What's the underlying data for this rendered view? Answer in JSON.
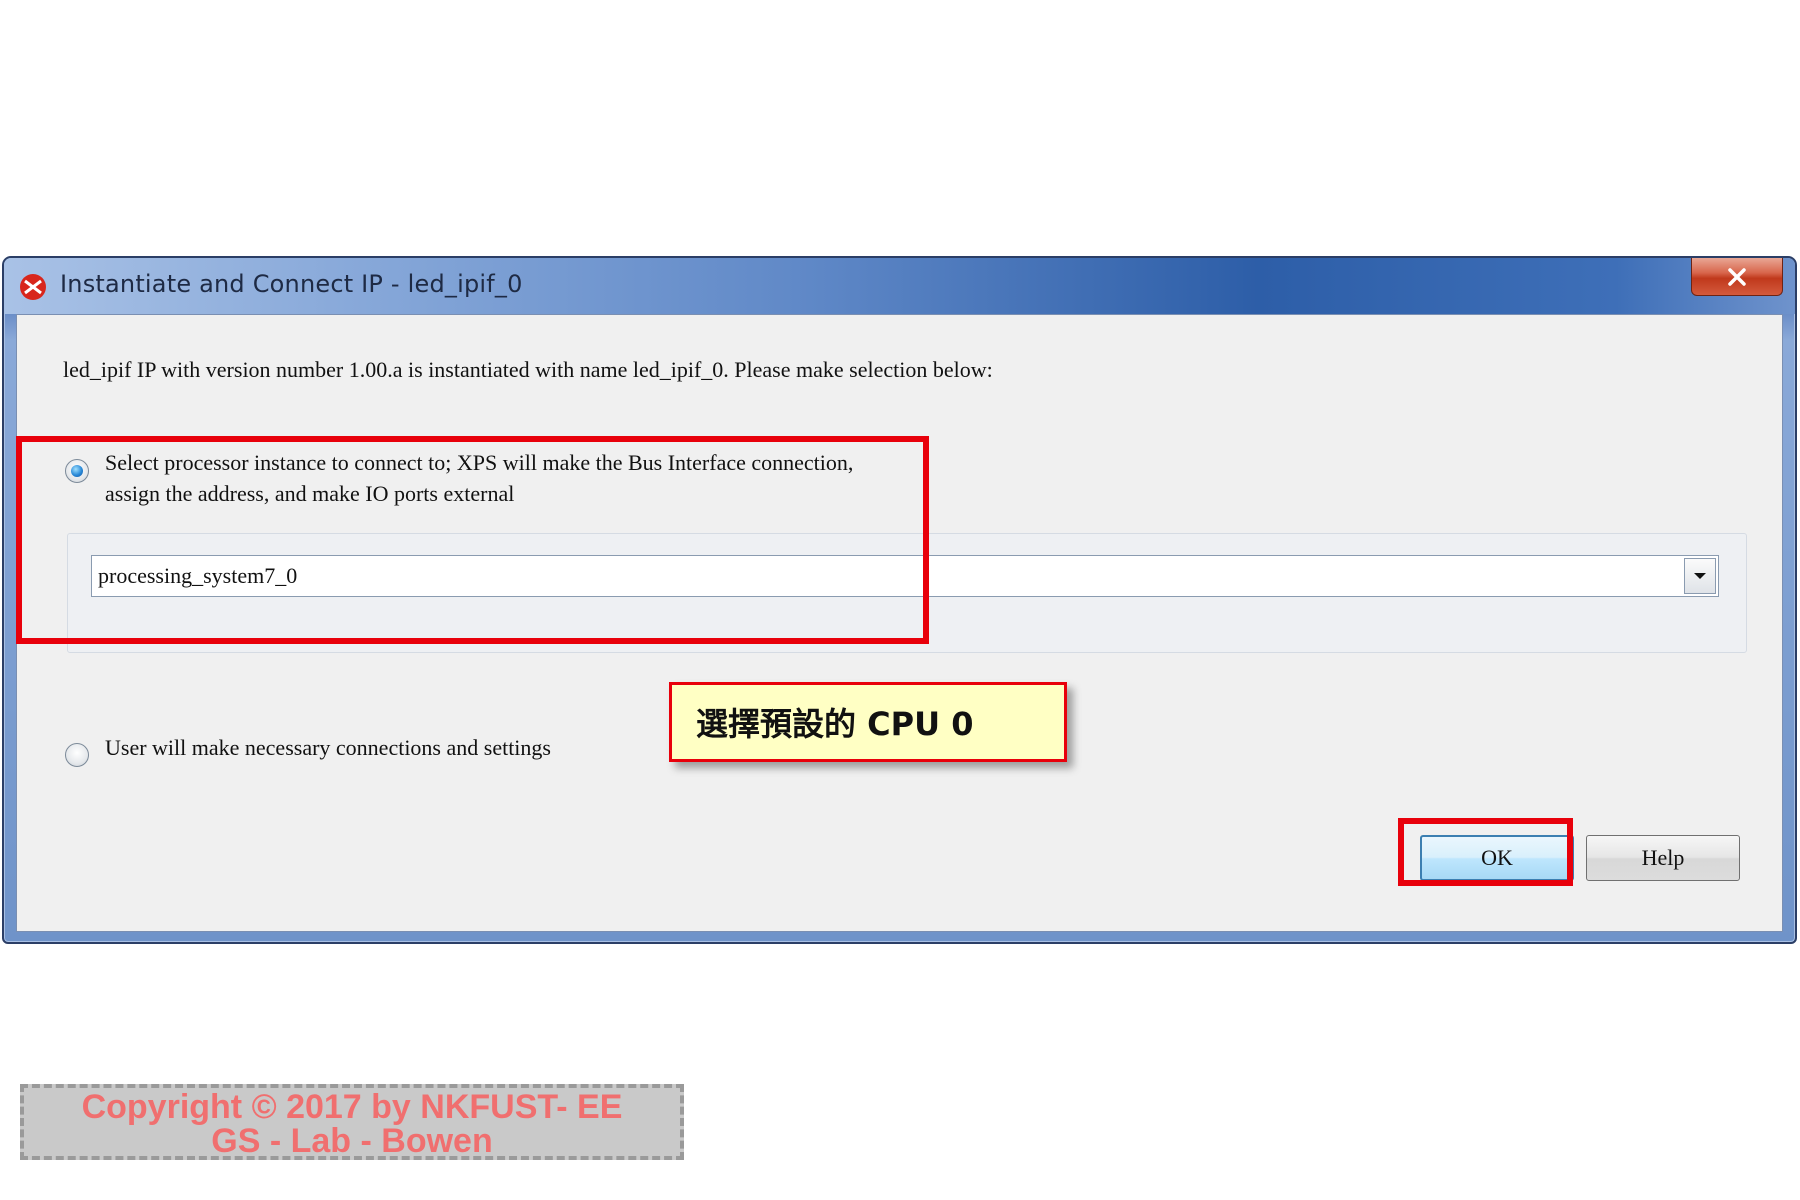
{
  "window": {
    "title": "Instantiate and Connect IP - led_ipif_0",
    "close_label": "X"
  },
  "dialog": {
    "intro": "led_ipif IP with version number 1.00.a is instantiated with name led_ipif_0. Please make selection below:",
    "option1_line1": "Select processor instance to connect to; XPS will make the Bus Interface connection,",
    "option1_line2": "assign the address, and make IO ports external",
    "option1_selected": true,
    "processor_value": "processing_system7_0",
    "option2": "User will make necessary connections and settings",
    "option2_selected": false,
    "ok_label": "OK",
    "help_label": "Help"
  },
  "annotation": {
    "callout": "選擇預設的 CPU 0",
    "highlight_color": "#e8000b"
  },
  "watermark": {
    "line1": "Copyright © 2017 by NKFUST- EE",
    "line2": "GS - Lab - Bowen"
  },
  "icons": {
    "app": "xilinx-logo-icon",
    "close": "close-icon",
    "dropdown": "chevron-down-icon"
  }
}
